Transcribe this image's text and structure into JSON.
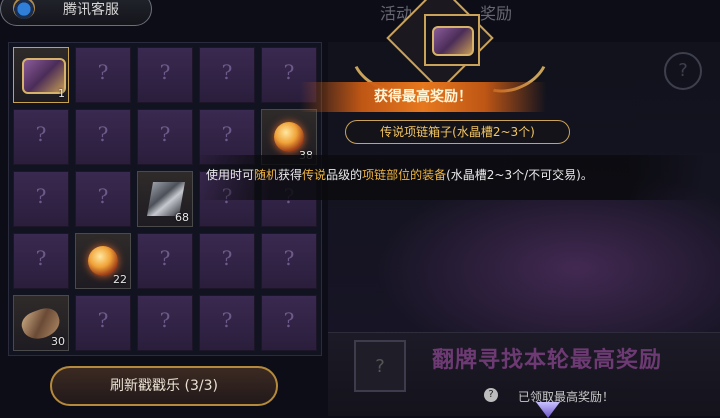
{
  "topbar": {
    "service_label": "腾讯客服",
    "title_left": "活动",
    "title_right": "奖励"
  },
  "grid": {
    "cells": [
      {
        "type": "item",
        "art": "chest",
        "count": "1",
        "gold": true
      },
      {
        "type": "hidden",
        "mark": "?"
      },
      {
        "type": "hidden",
        "mark": "?"
      },
      {
        "type": "hidden",
        "mark": "?"
      },
      {
        "type": "hidden",
        "mark": "?"
      },
      {
        "type": "hidden",
        "mark": "?"
      },
      {
        "type": "hidden",
        "mark": "?"
      },
      {
        "type": "hidden",
        "mark": "?"
      },
      {
        "type": "hidden",
        "mark": "?"
      },
      {
        "type": "item",
        "art": "orb",
        "count": "38"
      },
      {
        "type": "hidden",
        "mark": "?"
      },
      {
        "type": "hidden",
        "mark": "?"
      },
      {
        "type": "item",
        "art": "metal",
        "count": "68"
      },
      {
        "type": "hidden",
        "mark": "?"
      },
      {
        "type": "hidden",
        "mark": "?"
      },
      {
        "type": "hidden",
        "mark": "?"
      },
      {
        "type": "item",
        "art": "orb",
        "count": "22"
      },
      {
        "type": "hidden",
        "mark": "?"
      },
      {
        "type": "hidden",
        "mark": "?"
      },
      {
        "type": "hidden",
        "mark": "?"
      },
      {
        "type": "item",
        "art": "ring",
        "count": "30"
      },
      {
        "type": "hidden",
        "mark": "?"
      },
      {
        "type": "hidden",
        "mark": "?"
      },
      {
        "type": "hidden",
        "mark": "?"
      },
      {
        "type": "hidden",
        "mark": "?"
      }
    ]
  },
  "refresh_button": "刷新戳戳乐 (3/3)",
  "popup": {
    "title": "获得最高奖励！",
    "item_name": "传说项链箱子(水晶槽2~3个)",
    "desc_parts": [
      "使用时可",
      "随机",
      "获得",
      "传说",
      "品级的",
      "项链部位的装备",
      "(水晶槽2~3个/不可交易)。"
    ]
  },
  "reward_panel": {
    "mystery_mark": "?",
    "find_text": "翻牌寻找本轮最高奖励",
    "claimed_text": "已领取最高奖励！",
    "claimed_icon_mark": "?",
    "corner_icon_mark": "?"
  }
}
